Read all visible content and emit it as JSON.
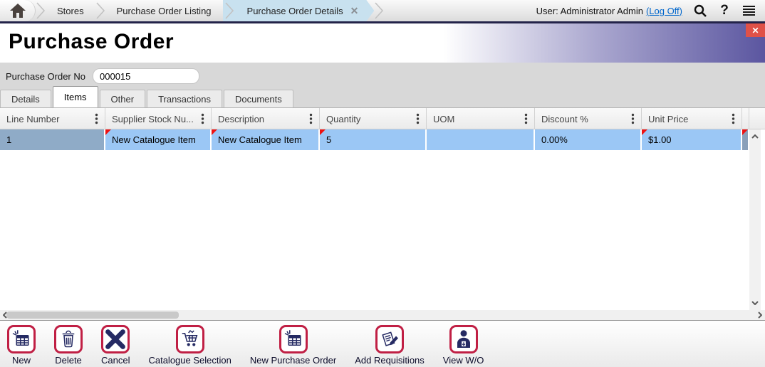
{
  "topbar": {
    "breadcrumbs": [
      {
        "label": "Stores"
      },
      {
        "label": "Purchase Order Listing"
      },
      {
        "label": "Purchase Order Details",
        "active": true,
        "closable": true
      }
    ],
    "crumb_close_glyph": "✕",
    "user_prefix": "User: Administrator Admin",
    "logoff": "(Log Off)",
    "help_glyph": "?"
  },
  "page": {
    "title": "Purchase Order",
    "close_glyph": "✕"
  },
  "form": {
    "po_label": "Purchase Order No",
    "po_value": "000015"
  },
  "tabs": [
    {
      "label": "Details",
      "active": false
    },
    {
      "label": "Items",
      "active": true
    },
    {
      "label": "Other",
      "active": false
    },
    {
      "label": "Transactions",
      "active": false
    },
    {
      "label": "Documents",
      "active": false
    }
  ],
  "table": {
    "columns": [
      {
        "label": "Line Number"
      },
      {
        "label": "Supplier Stock Nu..."
      },
      {
        "label": "Description"
      },
      {
        "label": "Quantity"
      },
      {
        "label": "UOM"
      },
      {
        "label": "Discount %"
      },
      {
        "label": "Unit Price"
      }
    ],
    "rows": [
      {
        "cells": [
          {
            "value": "1",
            "selected": true,
            "modified": false
          },
          {
            "value": "New Catalogue Item",
            "modified": true
          },
          {
            "value": "New Catalogue Item",
            "modified": true
          },
          {
            "value": "5",
            "modified": true
          },
          {
            "value": "",
            "modified": false
          },
          {
            "value": "0.00%",
            "modified": false
          },
          {
            "value": "$1.00",
            "modified": true
          }
        ]
      }
    ]
  },
  "toolbar": {
    "buttons": [
      {
        "label": "New",
        "icon": "new-grid-icon"
      },
      {
        "label": "Delete",
        "icon": "trash-icon"
      },
      {
        "label": "Cancel",
        "icon": "cancel-x-icon"
      },
      {
        "label": "Catalogue Selection",
        "icon": "shopping-cart-icon"
      },
      {
        "label": "New Purchase Order",
        "icon": "new-grid-icon"
      },
      {
        "label": "Add Requisitions",
        "icon": "note-pencil-icon"
      },
      {
        "label": "View W/O",
        "icon": "person-document-icon"
      }
    ]
  },
  "colors": {
    "crimson_border": "#c01f44",
    "navy_glyph": "#252a63",
    "active_crumb": "#c8e1ef",
    "title_purple": "#5b56a0",
    "close_red": "#e05148",
    "selected_cell": "#8fabc7",
    "row_blue": "#9bc7f5",
    "modified_flag_red": "#ee1111",
    "link_blue": "#0066cc",
    "topbar_border_navy": "#232349"
  }
}
